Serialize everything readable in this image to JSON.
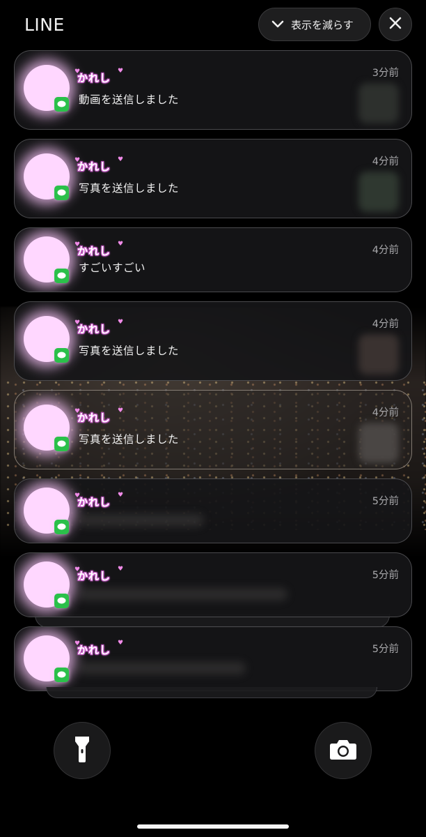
{
  "header": {
    "app_name": "LINE",
    "show_less_label": "表示を減らす"
  },
  "notifications": [
    {
      "sender": "かれし",
      "message": "動画を送信しました",
      "time": "3分前",
      "has_thumbnail": true
    },
    {
      "sender": "かれし",
      "message": "写真を送信しました",
      "time": "4分前",
      "has_thumbnail": true
    },
    {
      "sender": "かれし",
      "message": "すごいすごい",
      "time": "4分前",
      "has_thumbnail": false
    },
    {
      "sender": "かれし",
      "message": "写真を送信しました",
      "time": "4分前",
      "has_thumbnail": true
    },
    {
      "sender": "かれし",
      "message": "写真を送信しました",
      "time": "4分前",
      "has_thumbnail": true
    },
    {
      "sender": "かれし",
      "message": "",
      "time": "5分前",
      "has_thumbnail": false
    },
    {
      "sender": "かれし",
      "message": "",
      "time": "5分前",
      "has_thumbnail": false
    },
    {
      "sender": "かれし",
      "message": "",
      "time": "5分前",
      "has_thumbnail": false
    }
  ],
  "icons": {
    "show_less": "chevron-down-icon",
    "close": "close-icon",
    "flashlight": "flashlight-icon",
    "camera": "camera-icon",
    "app_badge": "line-app-icon"
  },
  "colors": {
    "avatar_glow": "#ffd7ff",
    "line_green": "#2bc04a",
    "sender_outline": "#c24fc4"
  }
}
